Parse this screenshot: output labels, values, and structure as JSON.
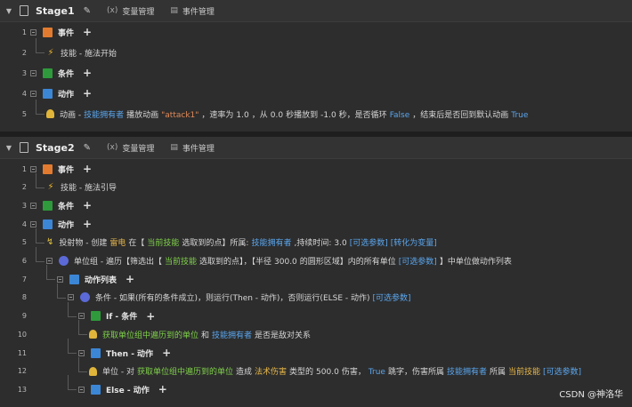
{
  "header_tools": {
    "variables": "变量管理",
    "events": "事件管理"
  },
  "stages": [
    {
      "title": "Stage1",
      "rows": [
        {
          "n": "1",
          "indent": 0,
          "icon": "event-icon",
          "label": "事件",
          "plus": true,
          "toggle": true
        },
        {
          "n": "2",
          "indent": 1,
          "icon": "bolt-icon",
          "segs": [
            {
              "t": "技能 - 施法开始",
              "c": "w"
            }
          ]
        },
        {
          "n": "3",
          "indent": 0,
          "icon": "condition-icon",
          "label": "条件",
          "plus": true,
          "toggle": true
        },
        {
          "n": "4",
          "indent": 0,
          "icon": "action-icon",
          "label": "动作",
          "plus": true,
          "toggle": true
        },
        {
          "n": "5",
          "indent": 1,
          "icon": "unit-icon",
          "segs": [
            {
              "t": "动画 -",
              "c": "w"
            },
            {
              "t": "技能拥有者",
              "c": "b"
            },
            {
              "t": "播放动画",
              "c": "w"
            },
            {
              "t": "\"attack1\"",
              "c": "s"
            },
            {
              "t": "，速率为",
              "c": "w"
            },
            {
              "t": "1.0",
              "c": "w"
            },
            {
              "t": "，从",
              "c": "w"
            },
            {
              "t": "0.0",
              "c": "w"
            },
            {
              "t": "秒播放到",
              "c": "w"
            },
            {
              "t": "-1.0",
              "c": "w"
            },
            {
              "t": "秒，是否循环",
              "c": "w"
            },
            {
              "t": "False",
              "c": "b"
            },
            {
              "t": "，结束后是否回到默认动画",
              "c": "w"
            },
            {
              "t": "True",
              "c": "b"
            }
          ]
        }
      ]
    },
    {
      "title": "Stage2",
      "rows": [
        {
          "n": "1",
          "indent": 0,
          "icon": "event-icon",
          "label": "事件",
          "plus": true,
          "toggle": true
        },
        {
          "n": "2",
          "indent": 1,
          "icon": "bolt-icon",
          "segs": [
            {
              "t": "技能 - 施法引导",
              "c": "w"
            }
          ]
        },
        {
          "n": "3",
          "indent": 0,
          "icon": "condition-icon",
          "label": "条件",
          "plus": true,
          "toggle": true
        },
        {
          "n": "4",
          "indent": 0,
          "icon": "action-icon",
          "label": "动作",
          "plus": true,
          "toggle": true
        },
        {
          "n": "5",
          "indent": 1,
          "icon": "projectile-icon",
          "segs": [
            {
              "t": "投射物 - 创建",
              "c": "w"
            },
            {
              "t": "雷电",
              "c": "o"
            },
            {
              "t": "在【",
              "c": "w"
            },
            {
              "t": "当前技能",
              "c": "g"
            },
            {
              "t": "选取到的点】所属:",
              "c": "w"
            },
            {
              "t": "技能拥有者",
              "c": "b"
            },
            {
              "t": ",持续时间:",
              "c": "w"
            },
            {
              "t": "3.0",
              "c": "w"
            },
            {
              "t": "[可选参数]",
              "c": "b"
            },
            {
              "t": "[转化为变量]",
              "c": "b"
            }
          ]
        },
        {
          "n": "6",
          "indent": 1,
          "icon": "unit-group-icon",
          "toggle": true,
          "segs": [
            {
              "t": "单位组 - 遍历【筛选出【",
              "c": "w"
            },
            {
              "t": "当前技能",
              "c": "g"
            },
            {
              "t": "选取到的点】，【半径",
              "c": "w"
            },
            {
              "t": "300.0",
              "c": "w"
            },
            {
              "t": "的圆形区域】内的所有单位",
              "c": "w"
            },
            {
              "t": "[可选参数]",
              "c": "b"
            },
            {
              "t": "】中单位做动作列表",
              "c": "w"
            }
          ]
        },
        {
          "n": "7",
          "indent": 2,
          "icon": "action-icon",
          "label": "动作列表",
          "plus": true,
          "toggle": true
        },
        {
          "n": "8",
          "indent": 3,
          "icon": "unit-group-icon",
          "toggle": true,
          "segs": [
            {
              "t": "条件 - 如果(所有的条件成立)，则运行(Then - 动作)，否则运行(ELSE - 动作)",
              "c": "w"
            },
            {
              "t": "[可选参数]",
              "c": "b"
            }
          ]
        },
        {
          "n": "9",
          "indent": 4,
          "icon": "condition-icon",
          "label": "If - 条件",
          "plus": true,
          "toggle": true
        },
        {
          "n": "10",
          "indent": 5,
          "icon": "unit-icon",
          "segs": [
            {
              "t": "获取单位组中遍历到的单位",
              "c": "g"
            },
            {
              "t": "和",
              "c": "w"
            },
            {
              "t": "技能拥有者",
              "c": "b"
            },
            {
              "t": "是否是敌对关系",
              "c": "w"
            }
          ]
        },
        {
          "n": "11",
          "indent": 4,
          "icon": "action-icon",
          "label": "Then - 动作",
          "plus": true,
          "toggle": true
        },
        {
          "n": "12",
          "indent": 5,
          "icon": "unit-icon",
          "segs": [
            {
              "t": "单位 - 对",
              "c": "w"
            },
            {
              "t": "获取单位组中遍历到的单位",
              "c": "g"
            },
            {
              "t": "造成",
              "c": "w"
            },
            {
              "t": "法术伤害",
              "c": "o"
            },
            {
              "t": "类型的",
              "c": "w"
            },
            {
              "t": "500.0",
              "c": "w"
            },
            {
              "t": "伤害，",
              "c": "w"
            },
            {
              "t": "True",
              "c": "b"
            },
            {
              "t": "跳字，伤害所属",
              "c": "w"
            },
            {
              "t": "技能拥有者",
              "c": "b"
            },
            {
              "t": "所属",
              "c": "w"
            },
            {
              "t": "当前技能",
              "c": "o"
            },
            {
              "t": "[可选参数]",
              "c": "b"
            }
          ]
        },
        {
          "n": "13",
          "indent": 4,
          "icon": "action-icon",
          "label": "Else - 动作",
          "plus": true,
          "toggle": true
        }
      ]
    }
  ],
  "watermark": "CSDN @神洛华"
}
